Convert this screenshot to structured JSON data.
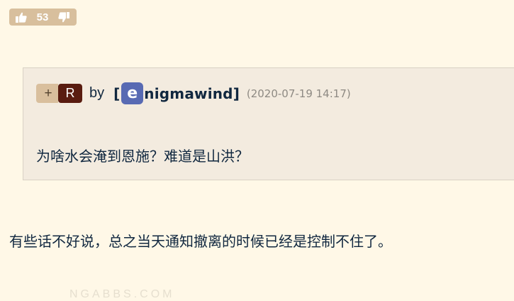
{
  "vote": {
    "count": "53",
    "like_icon": "thumbs-up-icon",
    "dislike_icon": "thumbs-down-icon"
  },
  "quote": {
    "plus_badge": "+",
    "reply_badge": "R",
    "by_label": "by",
    "bracket_open": "[",
    "avatar_letter": "e",
    "username": "nigmawind",
    "bracket_close": "]",
    "timestamp": "(2020-07-19 14:17)",
    "text": "为啥水会淹到恩施？难道是山洪？"
  },
  "reply": {
    "text": "有些话不好说，总之当天通知撤离的时候已经是控制不住了。"
  },
  "watermark": "NGABBS.COM",
  "colors": {
    "page_bg": "#fff8e7",
    "vote_bg": "#d8bf9d",
    "quote_bg": "#f3ebdf",
    "reply_badge_bg": "#591c10",
    "avatar_bg": "#586ab3",
    "text": "#10273f",
    "timestamp": "#8e8a83"
  }
}
